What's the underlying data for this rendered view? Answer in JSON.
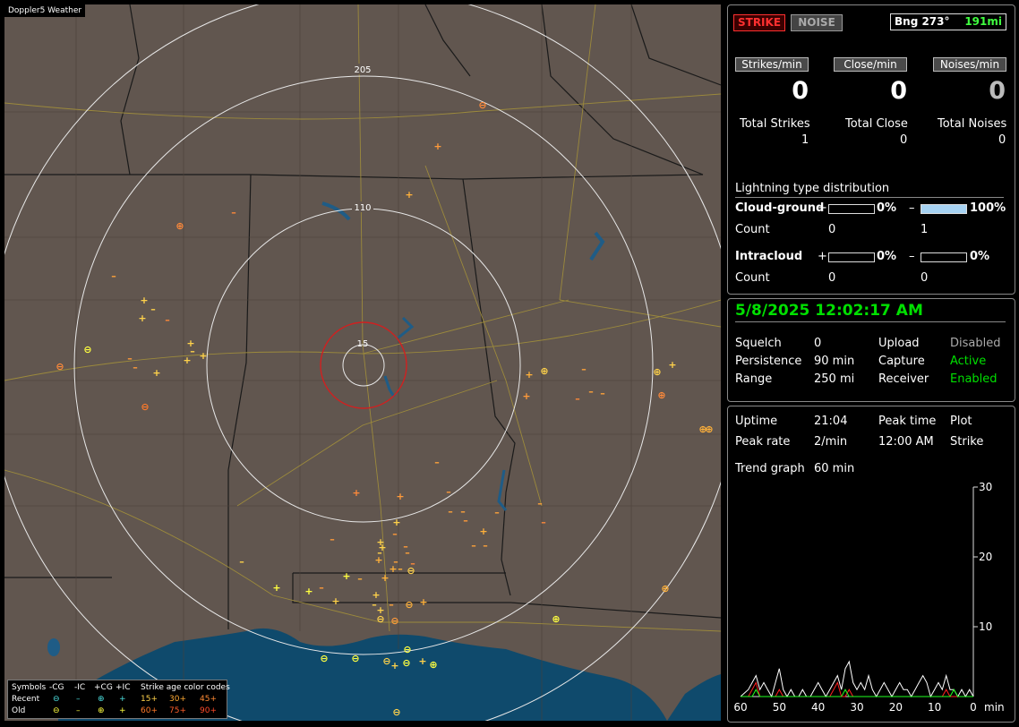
{
  "map": {
    "title": "Doppler5 Weather",
    "ring_labels": [
      "205",
      "110",
      "15"
    ],
    "legend": {
      "header": [
        "Symbols",
        "-CG",
        "-IC",
        "+CG",
        "+IC",
        "Strike age color codes"
      ],
      "recent_label": "Recent",
      "old_label": "Old",
      "recent_ages": [
        "15+",
        "30+",
        "45+"
      ],
      "old_ages": [
        "60+",
        "75+",
        "90+"
      ]
    }
  },
  "status": {
    "strike_label": "STRIKE",
    "noise_label": "NOISE",
    "bearing": "Bng 273°",
    "distance": "191mi"
  },
  "rates": [
    {
      "label": "Strikes/min",
      "value": "0"
    },
    {
      "label": "Close/min",
      "value": "0"
    },
    {
      "label": "Noises/min",
      "value": "0"
    }
  ],
  "totals": [
    {
      "label": "Total Strikes",
      "value": "1"
    },
    {
      "label": "Total Close",
      "value": "0"
    },
    {
      "label": "Total Noises",
      "value": "0"
    }
  ],
  "distribution": {
    "title": "Lightning type distribution",
    "cloud_ground_label": "Cloud-ground",
    "intracloud_label": "Intracloud",
    "count_label": "Count",
    "plus_sign": "+",
    "minus_sign": "–",
    "cg_plus_pct": "0%",
    "cg_plus_frac": 0,
    "cg_minus_pct": "100%",
    "cg_minus_frac": 1,
    "cg_plus_count": "0",
    "cg_minus_count": "1",
    "ic_plus_pct": "0%",
    "ic_plus_frac": 0,
    "ic_minus_pct": "0%",
    "ic_minus_frac": 0,
    "ic_plus_count": "0",
    "ic_minus_count": "0"
  },
  "settings": {
    "datetime": "5/8/2025 12:02:17 AM",
    "squelch_label": "Squelch",
    "squelch": "0",
    "persistence_label": "Persistence",
    "persistence": "90 min",
    "range_label": "Range",
    "range": "250 mi",
    "upload_label": "Upload",
    "upload": "Disabled",
    "capture_label": "Capture",
    "capture": "Active",
    "receiver_label": "Receiver",
    "receiver": "Enabled"
  },
  "trend": {
    "uptime_label": "Uptime",
    "uptime": "21:04",
    "peak_time_label": "Peak time",
    "plot_label": "Plot",
    "peak_rate_label": "Peak rate",
    "peak_rate": "2/min",
    "peak_time": "12:00 AM",
    "plot": "Strike",
    "trend_graph_label": "Trend graph",
    "trend_graph": "60 min",
    "y_ticks": [
      "30",
      "20",
      "10"
    ],
    "x_ticks": [
      "60",
      "50",
      "40",
      "30",
      "20",
      "10",
      "0"
    ],
    "x_unit": "min"
  },
  "chart_data": {
    "type": "line",
    "x": [
      60,
      58,
      57,
      56,
      55,
      54,
      53,
      52,
      51,
      50,
      49,
      48,
      47,
      46,
      45,
      44,
      43,
      42,
      41,
      40,
      39,
      38,
      37,
      36,
      35,
      34,
      33,
      32,
      31,
      30,
      29,
      28,
      27,
      26,
      25,
      24,
      23,
      22,
      21,
      20,
      19,
      18,
      17,
      16,
      15,
      14,
      13,
      12,
      11,
      10,
      9,
      8,
      7,
      6,
      5,
      4,
      3,
      2,
      1,
      0
    ],
    "series": [
      {
        "color": "#ffffff",
        "values": [
          0,
          1,
          2,
          3,
          1,
          2,
          1,
          0,
          2,
          4,
          1,
          0,
          1,
          0,
          0,
          1,
          0,
          0,
          1,
          2,
          1,
          0,
          1,
          2,
          3,
          1,
          4,
          5,
          2,
          1,
          2,
          1,
          3,
          1,
          0,
          1,
          2,
          1,
          0,
          1,
          2,
          1,
          1,
          0,
          1,
          2,
          3,
          2,
          0,
          1,
          2,
          1,
          3,
          1,
          1,
          0,
          1,
          0,
          1,
          0
        ]
      },
      {
        "color": "#ff2020",
        "values": [
          0,
          0,
          1,
          2,
          0,
          0,
          0,
          0,
          0,
          1,
          0,
          0,
          0,
          0,
          0,
          0,
          0,
          0,
          0,
          0,
          0,
          0,
          0,
          1,
          2,
          0,
          0,
          1,
          0,
          0,
          0,
          0,
          0,
          0,
          0,
          0,
          0,
          0,
          0,
          0,
          0,
          0,
          0,
          0,
          0,
          0,
          0,
          0,
          0,
          0,
          0,
          0,
          1,
          0,
          0,
          0,
          0,
          0,
          0,
          0
        ]
      },
      {
        "color": "#20ff20",
        "values": [
          0,
          0,
          0,
          1,
          0,
          0,
          0,
          0,
          0,
          0,
          0,
          0,
          0,
          0,
          0,
          0,
          0,
          0,
          0,
          0,
          0,
          0,
          0,
          0,
          0,
          0,
          1,
          0,
          0,
          0,
          0,
          0,
          0,
          0,
          0,
          0,
          0,
          0,
          0,
          0,
          0,
          0,
          0,
          0,
          0,
          0,
          0,
          0,
          0,
          0,
          0,
          0,
          0,
          0,
          1,
          0,
          0,
          0,
          0,
          0
        ]
      }
    ],
    "ylim": [
      0,
      30
    ],
    "xlim": [
      60,
      0
    ]
  }
}
